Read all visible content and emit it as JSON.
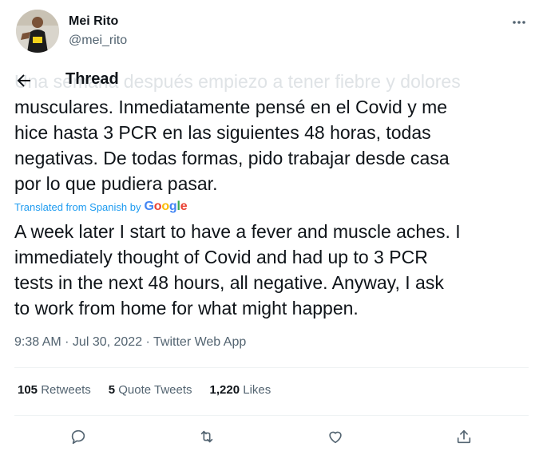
{
  "author": {
    "name": "Mei Rito",
    "handle": "@mei_rito"
  },
  "header": {
    "title": "Thread"
  },
  "tweet": {
    "original_lines": [
      "Una semana después empiezo a tener fiebre y dolores",
      "musculares. Inmediatamente pensé en el Covid y me",
      "hice hasta 3 PCR en las siguientes 48 horas, todas",
      "negativas. De todas formas, pido trabajar desde casa",
      "por lo que pudiera pasar."
    ],
    "translated_label": "Translated from Spanish by",
    "translated_brand": "Google",
    "translation_lines": [
      "A week later I start to have a fever and muscle aches. I",
      "immediately thought of Covid and had up to 3 PCR",
      "tests in the next 48 hours, all negative. Anyway, I ask",
      "to work from home for what might happen."
    ],
    "timestamp": "9:38 AM · Jul 30, 2022 · Twitter Web App"
  },
  "stats": {
    "retweets_count": "105",
    "retweets_label": "Retweets",
    "quotes_count": "5",
    "quotes_label": "Quote Tweets",
    "likes_count": "1,220",
    "likes_label": "Likes"
  },
  "icons": {
    "more": "more-dots-icon",
    "back": "arrow-left-icon",
    "reply": "reply-icon",
    "retweet": "retweet-icon",
    "like": "heart-icon",
    "share": "share-icon"
  },
  "colors": {
    "accent": "#1d9bf0",
    "secondary_text": "#536471",
    "primary_text": "#0f1419"
  }
}
